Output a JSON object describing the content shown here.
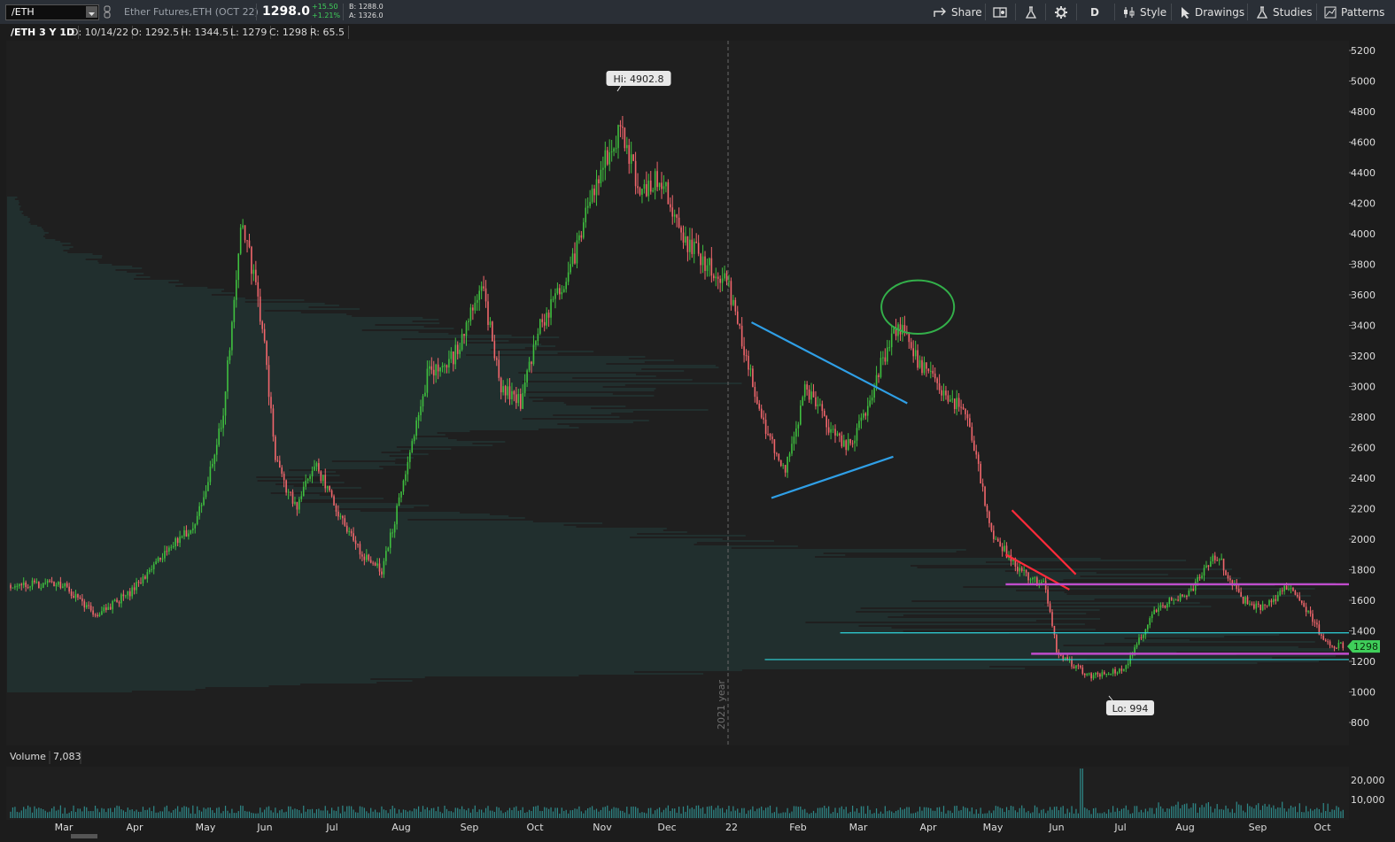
{
  "toolbar": {
    "symbol_value": "/ETH",
    "instrument_name": "Ether Futures,ETH (OCT 22)",
    "last_price": "1298.0",
    "net_change": "+15.50",
    "pct_change": "+1.21%",
    "bid": "B: 1288.0",
    "ask": "A: 1326.0",
    "share_label": "Share",
    "period_label": "D",
    "style_label": "Style",
    "drawings_label": "Drawings",
    "studies_label": "Studies",
    "patterns_label": "Patterns"
  },
  "infobar": {
    "symbol_period": "/ETH 3 Y 1D",
    "date": "D: 10/14/22",
    "open": "O: 1292.5",
    "high": "H: 1344.5",
    "low": "L: 1279",
    "close": "C: 1298",
    "range": "R: 65.5"
  },
  "volume_panel": {
    "label": "Volume",
    "value": "7,083"
  },
  "colors": {
    "up": "#3fbf3f",
    "down": "#f0666c",
    "triangle": "#2f9fe6",
    "wedge": "#ff2a3a",
    "level_magenta": "#c04ccc",
    "level_cyan": "#2fd6dc",
    "circle": "#33b04a",
    "price_tag": "#3fcf5a"
  },
  "chart_data": {
    "type": "candlestick",
    "symbol": "/ETH",
    "interval": "1D",
    "span": "3 Y",
    "price_axis": {
      "range": [
        800,
        5300
      ],
      "ticks": [
        800,
        1000,
        1200,
        1400,
        1600,
        1800,
        2000,
        2200,
        2400,
        2600,
        2800,
        3000,
        3200,
        3400,
        3600,
        3800,
        4000,
        4200,
        4400,
        4600,
        4800,
        5000,
        5200
      ]
    },
    "time_axis": {
      "labels": [
        "Mar",
        "Apr",
        "May",
        "Jun",
        "Jul",
        "Aug",
        "Sep",
        "Oct",
        "Nov",
        "Dec",
        "22",
        "Feb",
        "Mar",
        "Apr",
        "May",
        "Jun",
        "Jul",
        "Aug",
        "Sep",
        "Oct"
      ]
    },
    "year_marker": "2021 year",
    "high_label": "Hi: 4902.8",
    "low_label": "Lo: 994",
    "current_price": "1298",
    "anchors": [
      {
        "month": 0,
        "price": 1700
      },
      {
        "month": 0.5,
        "price": 1500
      },
      {
        "month": 1,
        "price": 1650
      },
      {
        "month": 1.5,
        "price": 1900
      },
      {
        "month": 2,
        "price": 2100
      },
      {
        "month": 2.4,
        "price": 2800
      },
      {
        "month": 2.7,
        "price": 4100
      },
      {
        "month": 3,
        "price": 3400
      },
      {
        "month": 3.2,
        "price": 2500
      },
      {
        "month": 3.5,
        "price": 2200
      },
      {
        "month": 3.8,
        "price": 2500
      },
      {
        "month": 4.1,
        "price": 2200
      },
      {
        "month": 4.5,
        "price": 1900
      },
      {
        "month": 4.8,
        "price": 1800
      },
      {
        "month": 5.1,
        "price": 2300
      },
      {
        "month": 5.5,
        "price": 3100
      },
      {
        "month": 5.9,
        "price": 3200
      },
      {
        "month": 6.3,
        "price": 3700
      },
      {
        "month": 6.6,
        "price": 3000
      },
      {
        "month": 6.9,
        "price": 2900
      },
      {
        "month": 7.2,
        "price": 3400
      },
      {
        "month": 7.6,
        "price": 3700
      },
      {
        "month": 8,
        "price": 4300
      },
      {
        "month": 8.4,
        "price": 4700
      },
      {
        "month": 8.7,
        "price": 4250
      },
      {
        "month": 9,
        "price": 4400
      },
      {
        "month": 9.3,
        "price": 4000
      },
      {
        "month": 9.7,
        "price": 3800
      },
      {
        "month": 10,
        "price": 3700
      },
      {
        "month": 10.3,
        "price": 3200
      },
      {
        "month": 10.6,
        "price": 2700
      },
      {
        "month": 10.9,
        "price": 2450
      },
      {
        "month": 11.2,
        "price": 3000
      },
      {
        "month": 11.6,
        "price": 2700
      },
      {
        "month": 11.9,
        "price": 2600
      },
      {
        "month": 12.3,
        "price": 3100
      },
      {
        "month": 12.6,
        "price": 3400
      },
      {
        "month": 12.9,
        "price": 3150
      },
      {
        "month": 13.3,
        "price": 2950
      },
      {
        "month": 13.6,
        "price": 2850
      },
      {
        "month": 13.75,
        "price": 2600
      },
      {
        "month": 14,
        "price": 2050
      },
      {
        "month": 14.4,
        "price": 1800
      },
      {
        "month": 14.8,
        "price": 1700
      },
      {
        "month": 15,
        "price": 1250
      },
      {
        "month": 15.5,
        "price": 1100
      },
      {
        "month": 16,
        "price": 1150
      },
      {
        "month": 16.5,
        "price": 1550
      },
      {
        "month": 17,
        "price": 1650
      },
      {
        "month": 17.4,
        "price": 1900
      },
      {
        "month": 17.8,
        "price": 1600
      },
      {
        "month": 18.1,
        "price": 1550
      },
      {
        "month": 18.5,
        "price": 1700
      },
      {
        "month": 18.8,
        "price": 1500
      },
      {
        "month": 19.1,
        "price": 1300
      },
      {
        "month": 19.6,
        "price": 1320
      },
      {
        "month": 19.9,
        "price": 1298
      }
    ],
    "volume_axis": {
      "ticks": [
        10000,
        20000
      ]
    },
    "drawings": [
      {
        "kind": "trendline",
        "color": "triangle",
        "from": {
          "month": 10.3,
          "price": 3420
        },
        "to": {
          "month": 12.7,
          "price": 2890
        }
      },
      {
        "kind": "trendline",
        "color": "triangle",
        "from": {
          "month": 10.6,
          "price": 2270
        },
        "to": {
          "month": 12.5,
          "price": 2540
        }
      },
      {
        "kind": "trendline",
        "color": "wedge",
        "from": {
          "month": 14.3,
          "price": 2190
        },
        "to": {
          "month": 15.3,
          "price": 1770
        }
      },
      {
        "kind": "trendline",
        "color": "wedge",
        "from": {
          "month": 14.2,
          "price": 1900
        },
        "to": {
          "month": 15.2,
          "price": 1670
        }
      },
      {
        "kind": "horizontal",
        "color": "level_magenta",
        "from_month": 14.2,
        "price": 1705
      },
      {
        "kind": "horizontal",
        "color": "level_magenta",
        "from_month": 14.6,
        "price": 1250
      },
      {
        "kind": "horizontal",
        "color": "level_cyan",
        "from_month": 11.7,
        "price": 1387
      },
      {
        "kind": "horizontal",
        "color": "level_cyan",
        "from_month": 10.5,
        "price": 1212
      },
      {
        "kind": "ellipse",
        "color": "circle",
        "month": 12.85,
        "price": 3520,
        "rx_months": 0.55,
        "ry_price": 175
      }
    ]
  }
}
